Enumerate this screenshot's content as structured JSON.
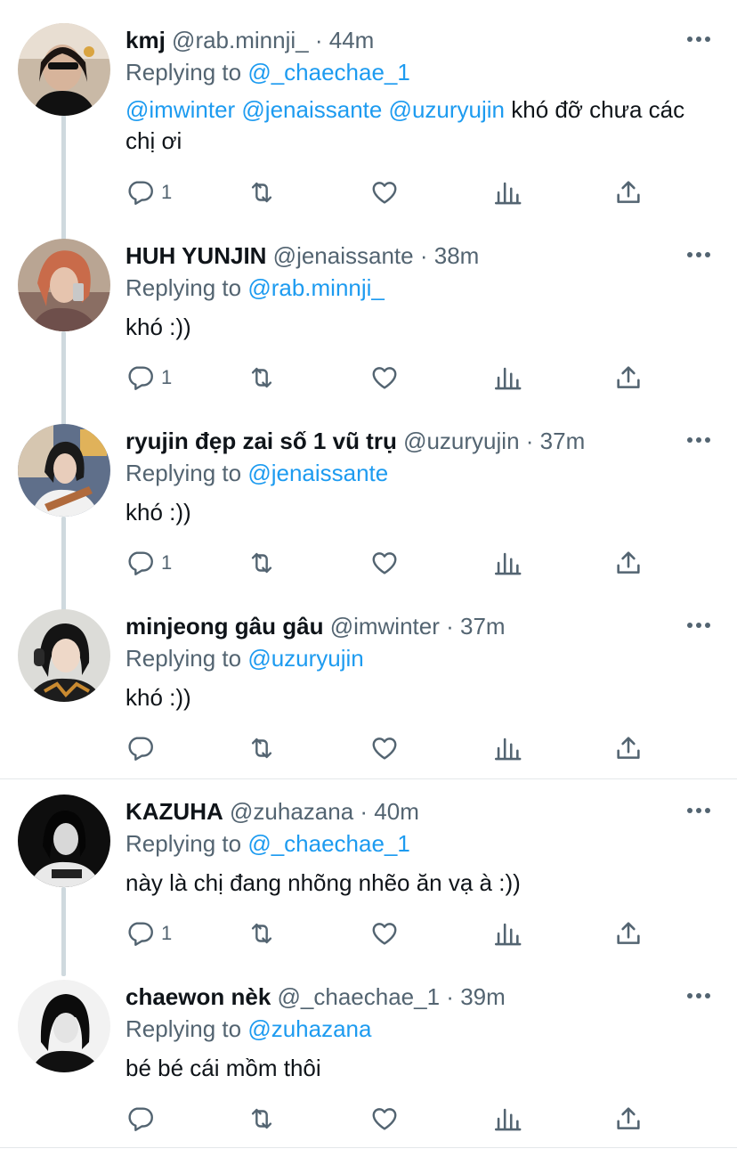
{
  "colors": {
    "accent": "#1d9bf0",
    "muted": "#536471",
    "text": "#0f1419",
    "line": "#cfd9de"
  },
  "labels": {
    "replying_to": "Replying to"
  },
  "tweets": [
    {
      "name": "kmj",
      "handle": "@rab.minnji_",
      "time": "44m",
      "separator": "·",
      "reply_to": "@_chaechae_1",
      "body_mentions": "@imwinter @jenaissante @uzuryujin",
      "body_text": " khó đỡ chưa các chị ơi",
      "reply_count": "1",
      "avatar": "avatar-photo"
    },
    {
      "name": "HUH YUNJIN",
      "handle": "@jenaissante",
      "time": "38m",
      "separator": "·",
      "reply_to": "@rab.minnji_",
      "body_mentions": "",
      "body_text": "khó :))",
      "reply_count": "1",
      "avatar": "avatar-photo"
    },
    {
      "name": "ryujin đẹp zai số 1 vũ trụ",
      "handle": "@uzuryujin",
      "time": "37m",
      "separator": "·",
      "reply_to": "@jenaissante",
      "body_mentions": "",
      "body_text": "khó :))",
      "reply_count": "1",
      "avatar": "avatar-photo"
    },
    {
      "name": "minjeong gâu gâu",
      "handle": "@imwinter",
      "time": "37m",
      "separator": "·",
      "reply_to": "@uzuryujin",
      "body_mentions": "",
      "body_text": "khó :))",
      "reply_count": "",
      "avatar": "avatar-photo"
    },
    {
      "name": "KAZUHA",
      "handle": "@zuhazana",
      "time": "40m",
      "separator": "·",
      "reply_to": "@_chaechae_1",
      "body_mentions": "",
      "body_text": "này là chị đang nhõng nhẽo ăn vạ à :))",
      "reply_count": "1",
      "avatar": "avatar-photo"
    },
    {
      "name": "chaewon nèk",
      "handle": "@_chaechae_1",
      "time": "39m",
      "separator": "·",
      "reply_to": "@zuhazana",
      "body_mentions": "",
      "body_text": "bé bé cái mồm thôi",
      "reply_count": "",
      "avatar": "avatar-photo"
    }
  ]
}
